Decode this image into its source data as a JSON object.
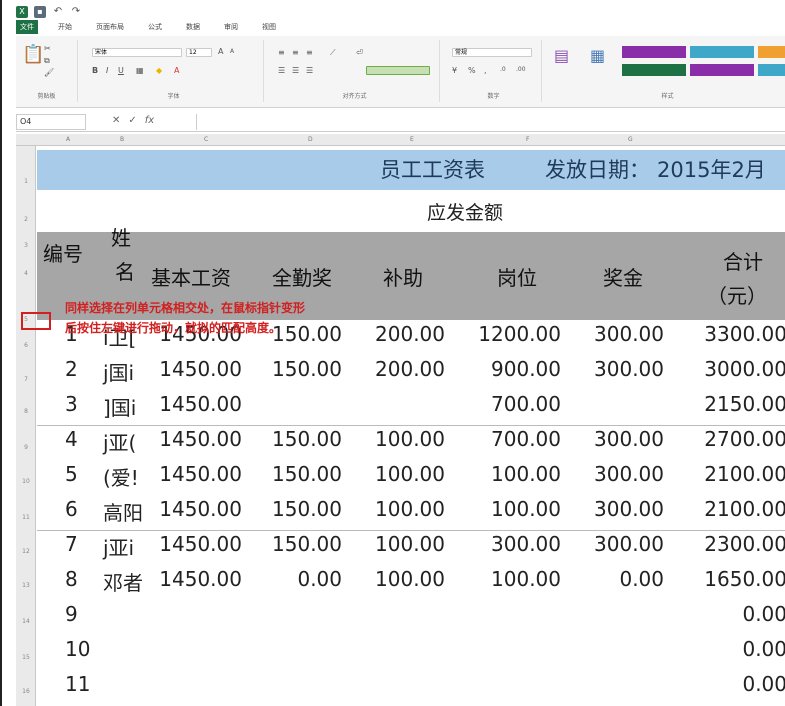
{
  "quick_access": {
    "excel_icon": "excel-icon",
    "save_icon": "save-icon",
    "undo_glyph": "↶",
    "redo_glyph": "↷"
  },
  "ribbon_tabs": [
    "文件",
    "开始",
    "页面布局",
    "公式",
    "数据",
    "审阅",
    "视图"
  ],
  "ribbon_groups": {
    "clipboard": "剪贴板",
    "font": "字体",
    "alignment": "对齐方式",
    "number": "数字",
    "styles": "样式"
  },
  "ribbon_font_name": "宋体",
  "ribbon_font_size": "12",
  "ribbon_number_format": "常规",
  "formula_bar": {
    "name_box": "O4",
    "cancel_glyph": "✕",
    "enter_glyph": "✓",
    "fx_glyph": "fx",
    "content": ""
  },
  "columns": [
    "A",
    "B",
    "C",
    "D",
    "E",
    "F",
    "G"
  ],
  "row_numbers": [
    "1",
    "2",
    "3",
    "4",
    "5",
    "6",
    "7",
    "8",
    "9",
    "10",
    "11",
    "12",
    "13",
    "14",
    "15",
    "16"
  ],
  "sheet": {
    "title": "员工工资表",
    "date_label": "发放日期：",
    "date_value": "2015年2月",
    "group_header": "应发金额",
    "headers": {
      "id": "编号",
      "name_top": "姓",
      "name_bottom": "名",
      "base": "基本工资",
      "attendance": "全勤奖",
      "subsidy": "补助",
      "position": "岗位",
      "bonus": "奖金",
      "total_top": "合计",
      "total_bottom": "（元）"
    },
    "tooltip_lines": [
      "同样选择在列单元格相交处，在鼠标指针变形",
      "后按住左键进行拖动，就拟的匹配高度。"
    ],
    "rows": [
      {
        "id": "1",
        "name": "i卫[",
        "base": "1450.00",
        "attendance": "150.00",
        "subsidy": "200.00",
        "position": "1200.00",
        "bonus": "300.00",
        "total": "3300.00"
      },
      {
        "id": "2",
        "name": "j国i",
        "base": "1450.00",
        "attendance": "150.00",
        "subsidy": "200.00",
        "position": "900.00",
        "bonus": "300.00",
        "total": "3000.00"
      },
      {
        "id": "3",
        "name": "]国i",
        "base": "1450.00",
        "attendance": "",
        "subsidy": "",
        "position": "700.00",
        "bonus": "",
        "total": "2150.00"
      },
      {
        "id": "4",
        "name": "j亚(",
        "base": "1450.00",
        "attendance": "150.00",
        "subsidy": "100.00",
        "position": "700.00",
        "bonus": "300.00",
        "total": "2700.00"
      },
      {
        "id": "5",
        "name": "(爱!",
        "base": "1450.00",
        "attendance": "150.00",
        "subsidy": "100.00",
        "position": "100.00",
        "bonus": "300.00",
        "total": "2100.00"
      },
      {
        "id": "6",
        "name": "高阳",
        "base": "1450.00",
        "attendance": "150.00",
        "subsidy": "100.00",
        "position": "100.00",
        "bonus": "300.00",
        "total": "2100.00"
      },
      {
        "id": "7",
        "name": "j亚i",
        "base": "1450.00",
        "attendance": "150.00",
        "subsidy": "100.00",
        "position": "300.00",
        "bonus": "300.00",
        "total": "2300.00"
      },
      {
        "id": "8",
        "name": "邓者",
        "base": "1450.00",
        "attendance": "0.00",
        "subsidy": "100.00",
        "position": "100.00",
        "bonus": "0.00",
        "total": "1650.00"
      },
      {
        "id": "9",
        "name": "",
        "base": "",
        "attendance": "",
        "subsidy": "",
        "position": "",
        "bonus": "",
        "total": "0.00"
      },
      {
        "id": "10",
        "name": "",
        "base": "",
        "attendance": "",
        "subsidy": "",
        "position": "",
        "bonus": "",
        "total": "0.00"
      },
      {
        "id": "11",
        "name": "",
        "base": "",
        "attendance": "",
        "subsidy": "",
        "position": "",
        "bonus": "",
        "total": "0.00"
      }
    ]
  },
  "colors": {
    "title_fill": "#a9cbea",
    "header_fill": "#a6a6a6",
    "tooltip_text": "#d21f1f",
    "excel_green": "#217346"
  }
}
